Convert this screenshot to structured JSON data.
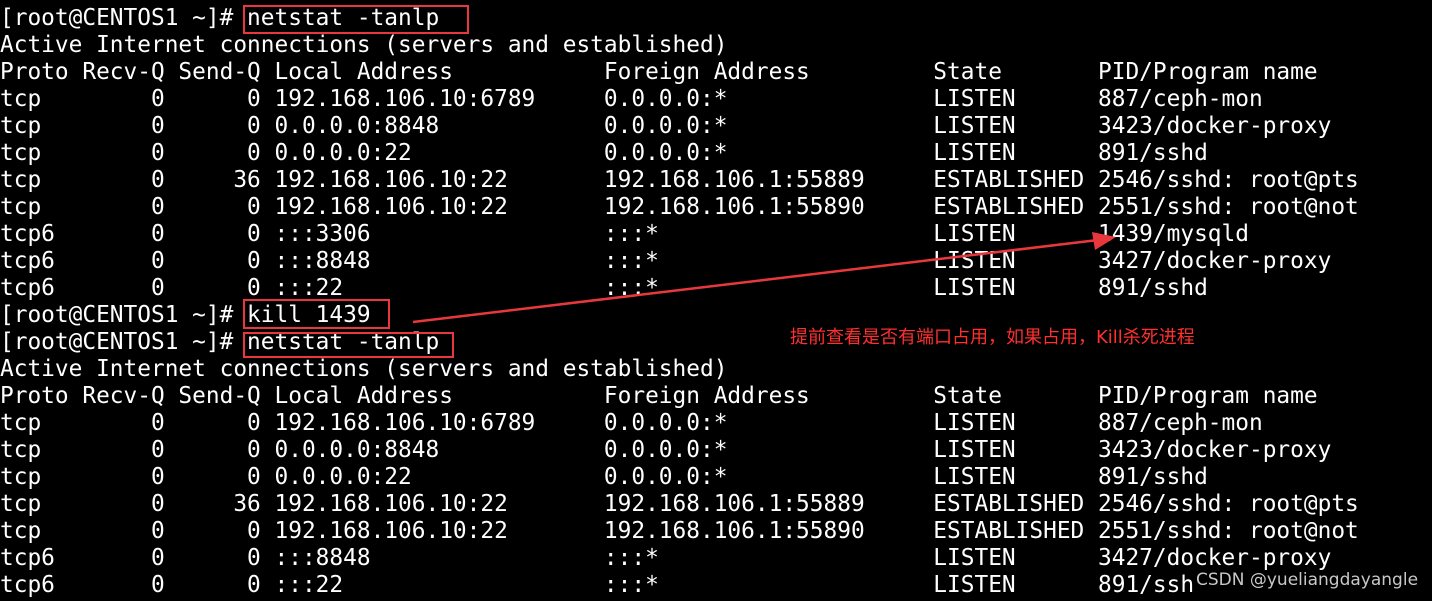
{
  "terminal": {
    "lines": [
      "[root@CENTOS1 ~]# netstat -tanlp",
      "Active Internet connections (servers and established)",
      "Proto Recv-Q Send-Q Local Address           Foreign Address         State       PID/Program name",
      "tcp        0      0 192.168.106.10:6789     0.0.0.0:*               LISTEN      887/ceph-mon",
      "tcp        0      0 0.0.0.0:8848            0.0.0.0:*               LISTEN      3423/docker-proxy",
      "tcp        0      0 0.0.0.0:22              0.0.0.0:*               LISTEN      891/sshd",
      "tcp        0     36 192.168.106.10:22       192.168.106.1:55889     ESTABLISHED 2546/sshd: root@pts",
      "tcp        0      0 192.168.106.10:22       192.168.106.1:55890     ESTABLISHED 2551/sshd: root@not",
      "tcp6       0      0 :::3306                 :::*                    LISTEN      1439/mysqld",
      "tcp6       0      0 :::8848                 :::*                    LISTEN      3427/docker-proxy",
      "tcp6       0      0 :::22                   :::*                    LISTEN      891/sshd",
      "[root@CENTOS1 ~]# kill 1439",
      "[root@CENTOS1 ~]# netstat -tanlp",
      "Active Internet connections (servers and established)",
      "Proto Recv-Q Send-Q Local Address           Foreign Address         State       PID/Program name",
      "tcp        0      0 192.168.106.10:6789     0.0.0.0:*               LISTEN      887/ceph-mon",
      "tcp        0      0 0.0.0.0:8848            0.0.0.0:*               LISTEN      3423/docker-proxy",
      "tcp        0      0 0.0.0.0:22              0.0.0.0:*               LISTEN      891/sshd",
      "tcp        0     36 192.168.106.10:22       192.168.106.1:55889     ESTABLISHED 2546/sshd: root@pts",
      "tcp        0      0 192.168.106.10:22       192.168.106.1:55890     ESTABLISHED 2551/sshd: root@not",
      "tcp6       0      0 :::8848                 :::*                    LISTEN      3427/docker-proxy",
      "tcp6       0      0 :::22                   :::*                    LISTEN      891/ssh"
    ]
  },
  "annotation": {
    "text": "提前查看是否有端口占用，如果占用，Kill杀死进程"
  },
  "watermark": {
    "text": "CSDN @yueliangdayangle"
  },
  "colors": {
    "background": "#000000",
    "text": "#ffffff",
    "highlight": "#e8383d",
    "annotation": "#ff3030"
  }
}
